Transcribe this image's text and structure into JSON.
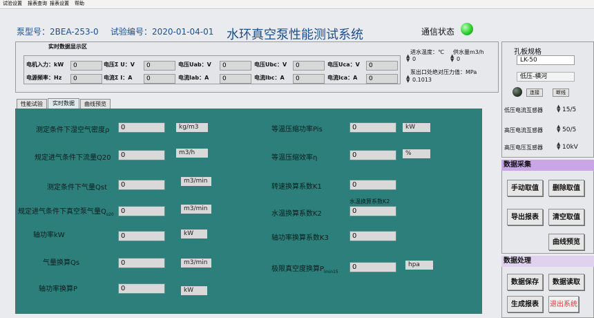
{
  "menu": [
    "试验设置",
    "报表查询",
    "报表设置",
    "帮助"
  ],
  "header": {
    "pump_model": "泵型号：2BEA-253-0",
    "test_no": "试验编号：2020-01-04-01",
    "title": "水环真空泵性能测试系统",
    "comm_status_label": "通信状态",
    "comm_status_color": "#2fcf2f"
  },
  "realtime": {
    "group_label": "实时数据显示区",
    "row1": [
      {
        "label": "电机入力：kW",
        "value": "0"
      },
      {
        "label": "电压Σ U：V",
        "value": "0"
      },
      {
        "label": "电压Uab：V",
        "value": "0"
      },
      {
        "label": "电压Ubc：V",
        "value": "0"
      },
      {
        "label": "电压Uca：V",
        "value": "0"
      }
    ],
    "row2": [
      {
        "label": "电源频率：Hz",
        "value": "0"
      },
      {
        "label": "电流Σ I：A",
        "value": "0"
      },
      {
        "label": "电流Iab：A",
        "value": "0"
      },
      {
        "label": "电流Ibc：A",
        "value": "0"
      },
      {
        "label": "电流Ica：A",
        "value": "0"
      }
    ],
    "water_temp_label": "进水温度：℃",
    "water_temp_value": "0",
    "water_flow_label": "供水量m3/h",
    "water_flow_value": "0",
    "outlet_pressure_label": "泵出口处绝对压力值：MPa",
    "outlet_pressure_value": "0.1013"
  },
  "tabs": [
    "性能试验",
    "实时数据",
    "曲线预览"
  ],
  "panel": {
    "left": [
      {
        "label": "测定条件下湿空气密度ρ",
        "value": "0",
        "unit": "kg/m3"
      },
      {
        "label": "规定进气条件下流量Q20",
        "value": "0",
        "unit": "m3/h"
      },
      {
        "label": "测定条件下气量Qst",
        "value": "0",
        "unit": "m3/min"
      },
      {
        "label": "规定进气条件下真空泵气量Q",
        "sub": "s20",
        "value": "0",
        "unit": "m3/min"
      },
      {
        "label": "轴功率kW",
        "value": "0",
        "unit": "kW"
      },
      {
        "label": "气量换算Qs",
        "value": "0",
        "unit": "m3/min"
      },
      {
        "label": "轴功率换算P",
        "value": "0",
        "unit": "kW"
      }
    ],
    "right": [
      {
        "label": "等温压缩功率Pis",
        "value": "0",
        "unit": "kW"
      },
      {
        "label": "等温压缩效率η",
        "value": "0",
        "unit": "%"
      },
      {
        "label": "转速换算系数K1",
        "value": "0",
        "unit": ""
      },
      {
        "label": "水温换算系数K2",
        "value": "0",
        "unit": "",
        "caption": "水温换算系数K2"
      },
      {
        "label": "轴功率换算系数K3",
        "value": "0",
        "unit": ""
      },
      {
        "label": "极限真空度换算P",
        "sub": "lmin15",
        "value": "0",
        "unit": "hpa"
      }
    ]
  },
  "sidebar": {
    "orifice_label": "孔板规格",
    "orifice_value": "LK-50",
    "voltage_mode": "低压-横河",
    "connect_btn": "连接",
    "disconnect_btn": "断线",
    "sensors": [
      {
        "label": "低压电流互感器",
        "value": "15/5"
      },
      {
        "label": "高压电流互感器",
        "value": "50/5"
      },
      {
        "label": "高压电压互感器",
        "value": "10kV"
      }
    ],
    "acq_title": "数据采集",
    "acq_buttons": [
      "手动取值",
      "删除取值",
      "导出报表",
      "清空取值",
      "曲线预览"
    ],
    "proc_title": "数据处理",
    "proc_buttons": [
      "数据保存",
      "数据读取",
      "生成报表",
      "退出系统"
    ]
  }
}
